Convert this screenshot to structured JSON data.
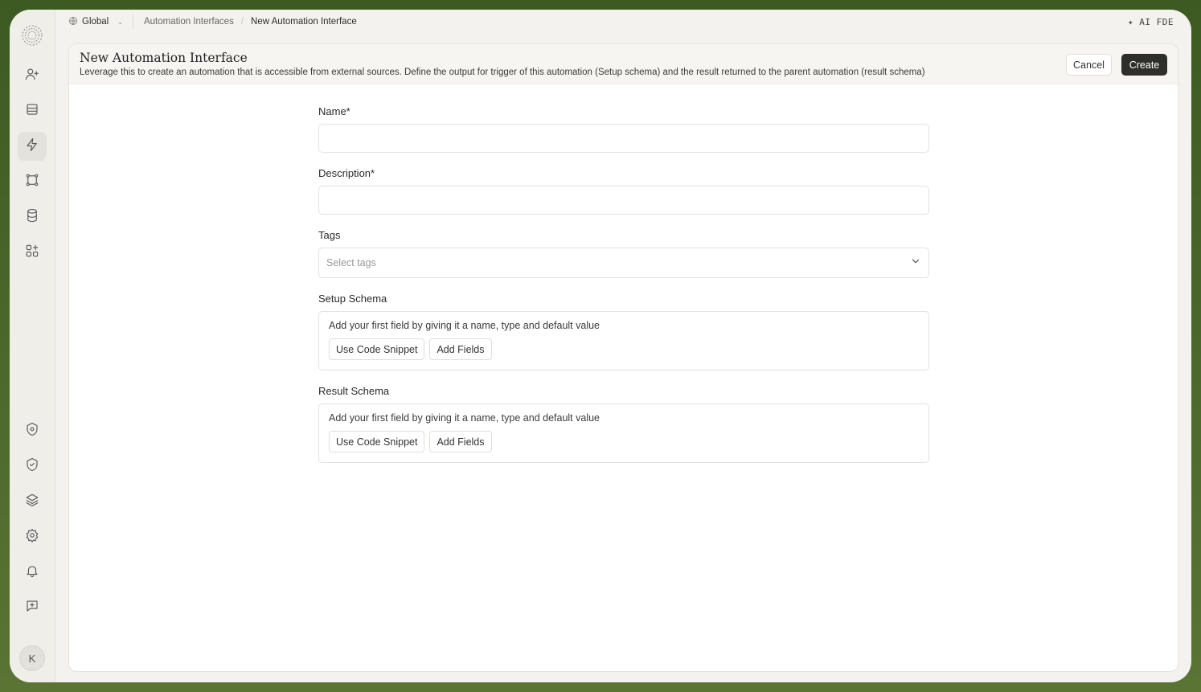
{
  "sidebar": {
    "logo_icon": "spiral-logo-icon",
    "nav_icons": [
      "user-plus-icon",
      "inbox-icon",
      "lightning-icon",
      "workflow-icon",
      "database-icon",
      "apps-add-icon"
    ],
    "bottom_icons": [
      "shield-settings-icon",
      "shield-check-icon",
      "layers-icon",
      "gear-icon",
      "bell-icon",
      "feedback-icon"
    ],
    "active_index": 2,
    "avatar_initial": "K"
  },
  "topbar": {
    "scope": "Global",
    "breadcrumb_parent": "Automation Interfaces",
    "breadcrumb_current": "New Automation Interface",
    "ai_label": "AI FDE"
  },
  "header": {
    "title": "New Automation Interface",
    "description": "Leverage this to create an automation that is accessible from external sources. Define the output for trigger of this automation (Setup schema) and the result returned to the parent automation (result schema)",
    "cancel_label": "Cancel",
    "create_label": "Create"
  },
  "form": {
    "name_label": "Name*",
    "name_value": "",
    "description_label": "Description*",
    "description_value": "",
    "tags_label": "Tags",
    "tags_placeholder": "Select tags",
    "setup_label": "Setup Schema",
    "setup_hint": "Add your first field by giving it a name, type and default value",
    "setup_snippet": "Use Code Snippet",
    "setup_add": "Add Fields",
    "result_label": "Result Schema",
    "result_hint": "Add your first field by giving it a name, type and default value",
    "result_snippet": "Use Code Snippet",
    "result_add": "Add Fields"
  },
  "colors": {
    "primary_button": "#2e2f2a",
    "background": "#f3f2ee",
    "frame": "#4a6a2b"
  }
}
